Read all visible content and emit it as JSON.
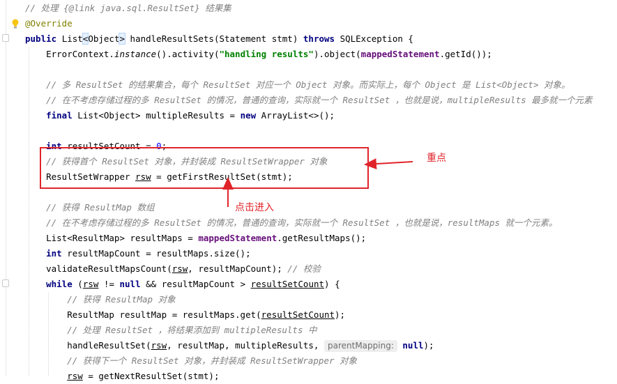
{
  "code_lines": [
    [
      {
        "t": "// 处理 {@link java.sql.ResultSet} 结果集",
        "c": "cm"
      }
    ],
    [
      {
        "t": "@Override",
        "c": "ann"
      }
    ],
    [
      {
        "t": "public ",
        "c": "kw"
      },
      {
        "t": "List"
      },
      {
        "t": "<",
        "c": "bm"
      },
      {
        "t": "Object"
      },
      {
        "t": ">",
        "c": "bm"
      },
      {
        "t": " handleResultSets(Statement stmt) "
      },
      {
        "t": "throws",
        "c": "kw"
      },
      {
        "t": " SQLException {"
      }
    ],
    [
      {
        "t": "    ErrorContext."
      },
      {
        "t": "instance",
        "c": "sit"
      },
      {
        "t": "().activity("
      },
      {
        "t": "\"handling results\"",
        "c": "str"
      },
      {
        "t": ").object("
      },
      {
        "t": "mappedStatement",
        "c": "fld"
      },
      {
        "t": ".getId());"
      }
    ],
    [],
    [
      {
        "t": "    // 多 ResultSet 的结果集合，每个 ResultSet 对应一个 Object 对象。而实际上，每个 Object 是 List<Object> 对象。",
        "c": "cm"
      }
    ],
    [
      {
        "t": "    // 在不考虑存储过程的多 ResultSet 的情况，普通的查询，实际就一个 ResultSet ，也就是说，multipleResults 最多就一个元素",
        "c": "cm"
      }
    ],
    [
      {
        "t": "    "
      },
      {
        "t": "final",
        "c": "kw"
      },
      {
        "t": " List<Object> multipleResults = "
      },
      {
        "t": "new",
        "c": "kw"
      },
      {
        "t": " ArrayList<>();"
      }
    ],
    [],
    [
      {
        "t": "    "
      },
      {
        "t": "int",
        "c": "kw"
      },
      {
        "t": " resultSetCount = "
      },
      {
        "t": "0",
        "c": "num"
      },
      {
        "t": ";"
      }
    ],
    [
      {
        "t": "    // 获得首个 ResultSet 对象，并封装成 ResultSetWrapper 对象",
        "c": "cm"
      }
    ],
    [
      {
        "t": "    ResultSetWrapper "
      },
      {
        "t": "rsw",
        "c": "ul"
      },
      {
        "t": " = getFirstResultSet(stmt);"
      }
    ],
    [],
    [
      {
        "t": "    // 获得 ResultMap 数组",
        "c": "cm"
      }
    ],
    [
      {
        "t": "    // 在不考虑存储过程的多 ResultSet 的情况，普通的查询，实际就一个 ResultSet ，也就是说，resultMaps 就一个元素。",
        "c": "cm"
      }
    ],
    [
      {
        "t": "    List<ResultMap> resultMaps = "
      },
      {
        "t": "mappedStatement",
        "c": "fld"
      },
      {
        "t": ".getResultMaps();"
      }
    ],
    [
      {
        "t": "    "
      },
      {
        "t": "int",
        "c": "kw"
      },
      {
        "t": " resultMapCount = resultMaps.size();"
      }
    ],
    [
      {
        "t": "    validateResultMapsCount("
      },
      {
        "t": "rsw",
        "c": "ul"
      },
      {
        "t": ", resultMapCount); "
      },
      {
        "t": "// 校验",
        "c": "cm"
      }
    ],
    [
      {
        "t": "    "
      },
      {
        "t": "while",
        "c": "kw"
      },
      {
        "t": " ("
      },
      {
        "t": "rsw",
        "c": "ul"
      },
      {
        "t": " != "
      },
      {
        "t": "null",
        "c": "kw"
      },
      {
        "t": " && resultMapCount > "
      },
      {
        "t": "resultSetCount",
        "c": "ul"
      },
      {
        "t": ") {"
      }
    ],
    [
      {
        "t": "        // 获得 ResultMap 对象",
        "c": "cm"
      }
    ],
    [
      {
        "t": "        ResultMap resultMap = resultMaps.get("
      },
      {
        "t": "resultSetCount",
        "c": "ul"
      },
      {
        "t": ");"
      }
    ],
    [
      {
        "t": "        // 处理 ResultSet ，将结果添加到 multipleResults 中",
        "c": "cm"
      }
    ],
    [
      {
        "t": "        handleResultSet("
      },
      {
        "t": "rsw",
        "c": "ul"
      },
      {
        "t": ", resultMap, multipleResults, "
      },
      {
        "t": "parentMapping:",
        "c": "hint"
      },
      {
        "t": " "
      },
      {
        "t": "null",
        "c": "kw"
      },
      {
        "t": ");"
      }
    ],
    [
      {
        "t": "        // 获得下一个 ResultSet 对象，并封装成 ResultSetWrapper 对象",
        "c": "cm"
      }
    ],
    [
      {
        "t": "        "
      },
      {
        "t": "rsw",
        "c": "ul"
      },
      {
        "t": " = getNextResultSet(stmt);"
      }
    ]
  ],
  "annotations": {
    "key_point": "重点",
    "click_into": "点击进入"
  },
  "colors": {
    "annotation_red": "#e0242a",
    "comment": "#808080",
    "keyword": "#000080",
    "string": "#008000",
    "field": "#660e7a"
  },
  "icons": {
    "gutter_bulb": "lightbulb-icon"
  }
}
